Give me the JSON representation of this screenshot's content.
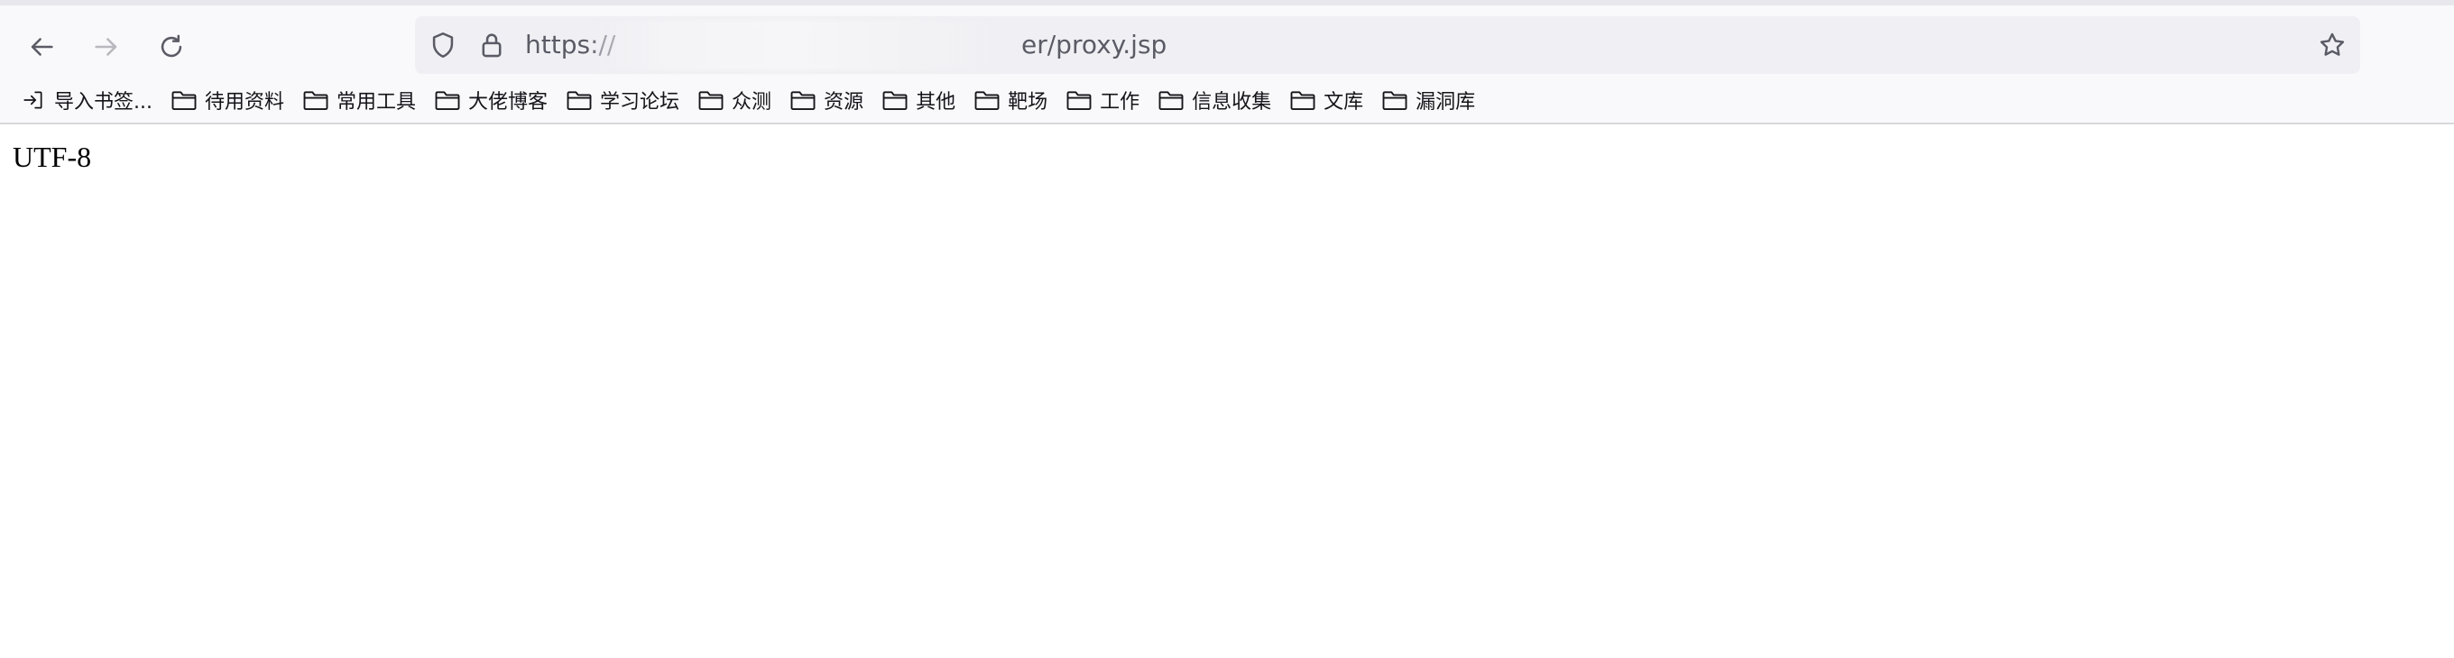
{
  "toolbar": {
    "url_prefix": "https://",
    "url_suffix": "er/proxy.jsp"
  },
  "bookmarks": [
    {
      "label": "导入书签...",
      "icon": "import-icon"
    },
    {
      "label": "待用资料",
      "icon": "folder-icon"
    },
    {
      "label": "常用工具",
      "icon": "folder-icon"
    },
    {
      "label": "大佬博客",
      "icon": "folder-icon"
    },
    {
      "label": "学习论坛",
      "icon": "folder-icon"
    },
    {
      "label": "众测",
      "icon": "folder-icon"
    },
    {
      "label": "资源",
      "icon": "folder-icon"
    },
    {
      "label": "其他",
      "icon": "folder-icon"
    },
    {
      "label": "靶场",
      "icon": "folder-icon"
    },
    {
      "label": "工作",
      "icon": "folder-icon"
    },
    {
      "label": "信息收集",
      "icon": "folder-icon"
    },
    {
      "label": "文库",
      "icon": "folder-icon"
    },
    {
      "label": "漏洞库",
      "icon": "folder-icon"
    }
  ],
  "page": {
    "body_text": "UTF-8"
  },
  "colors": {
    "toolbar_bg": "#f9f9fb",
    "urlbar_bg": "#f0f0f4",
    "text": "#15141a"
  }
}
